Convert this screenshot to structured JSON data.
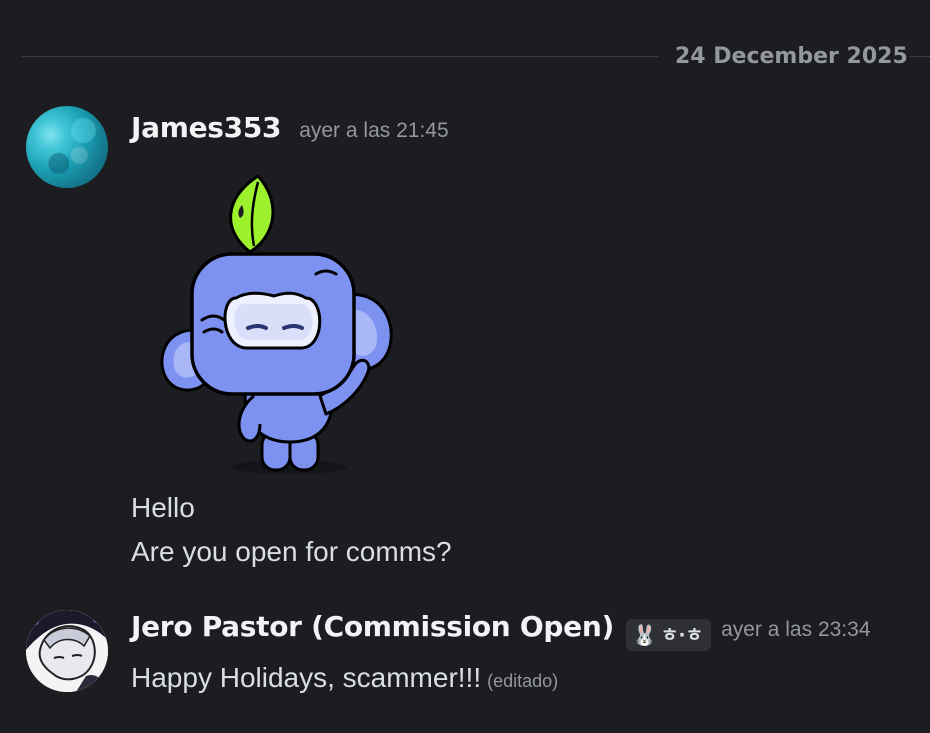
{
  "date_divider": {
    "label": "24 December 2025"
  },
  "messages": [
    {
      "author": "James353",
      "timestamp": "ayer a las 21:45",
      "sticker": "wumpus-sticker",
      "lines": [
        "Hello",
        "Are you open for comms?"
      ]
    },
    {
      "author": "Jero Pastor (Commission Open)",
      "tag_icon": "🐰",
      "tag_text": "ㅎ·ㅎ",
      "timestamp": "ayer a las 23:34",
      "text": "Happy Holidays, scammer!!!",
      "edited_label": "(editado)"
    }
  ]
}
